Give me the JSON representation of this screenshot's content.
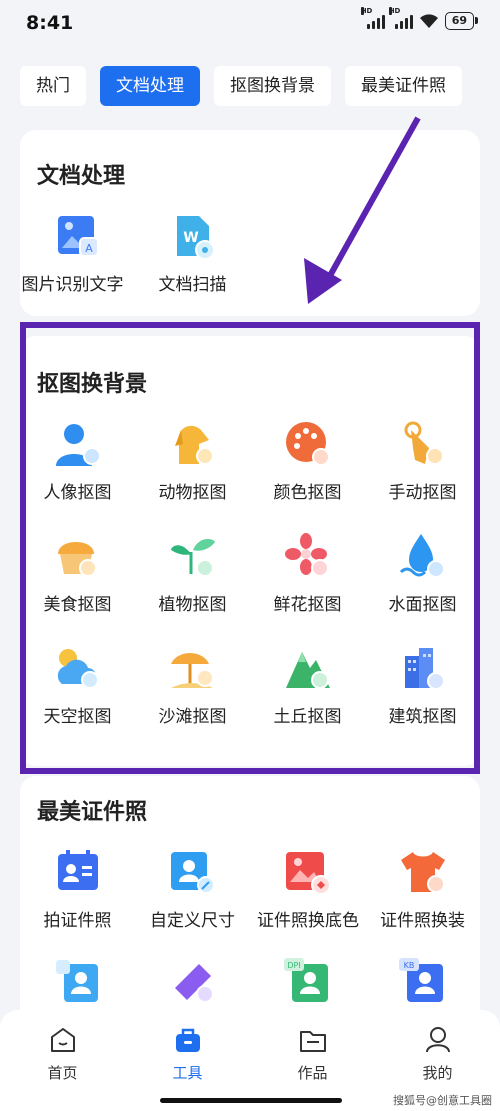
{
  "status": {
    "time": "8:41",
    "battery": "69"
  },
  "tabs": [
    "热门",
    "文档处理",
    "抠图换背景",
    "最美证件照"
  ],
  "doc_section": {
    "title": "文档处理",
    "items": [
      "图片识别文字",
      "文档扫描"
    ]
  },
  "cutout_section": {
    "title": "抠图换背景",
    "items": [
      "人像抠图",
      "动物抠图",
      "颜色抠图",
      "手动抠图",
      "美食抠图",
      "植物抠图",
      "鲜花抠图",
      "水面抠图",
      "天空抠图",
      "沙滩抠图",
      "土丘抠图",
      "建筑抠图"
    ]
  },
  "id_section": {
    "title": "最美证件照",
    "items": [
      "拍证件照",
      "自定义尺寸",
      "证件照换底色",
      "证件照换装"
    ]
  },
  "bottom_nav": [
    "首页",
    "工具",
    "作品",
    "我的"
  ],
  "watermark": "搜狐号@创意工具圈",
  "colors": {
    "accent": "#1e6ef0",
    "highlight_box": "#5a23b0"
  }
}
